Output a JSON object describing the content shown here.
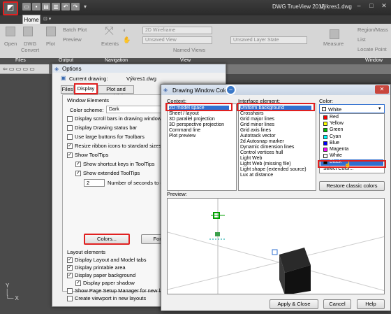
{
  "title_bar": {
    "app_name": "DWG TrueView 2012",
    "document": "Výkres1.dwg"
  },
  "tabs": {
    "home": "Home"
  },
  "ribbon": {
    "open": "Open",
    "dwg_convert_1": "DWG",
    "dwg_convert_2": "Convert",
    "plot": "Plot",
    "batch_plot": "Batch Plot",
    "preview": "Preview",
    "extents": "Extents",
    "visual_style": "2D Wireframe",
    "view": "Unsaved View",
    "named_views": "Named Views",
    "layer_state": "Unsaved Layer State",
    "measure": "Measure",
    "region_mass": "Region/Mass",
    "list": "List",
    "locate_point": "Locate Point",
    "panel_files": "Files",
    "panel_output": "Output",
    "panel_navigation": "Navigation",
    "panel_view": "View",
    "panel_window": "Window"
  },
  "options": {
    "title": "Options",
    "current_drawing_label": "Current drawing:",
    "current_drawing": "Výkres1.dwg",
    "tabs": [
      "Files",
      "Display",
      "Plot and Publish"
    ],
    "window_elements": "Window Elements",
    "color_scheme_label": "Color scheme:",
    "color_scheme": "Dark",
    "checks": [
      {
        "label": "Display scroll bars in drawing window",
        "checked": false
      },
      {
        "label": "Display Drawing status bar",
        "checked": false
      },
      {
        "label": "Use large buttons for Toolbars",
        "checked": false
      },
      {
        "label": "Resize ribbon icons to standard sizes",
        "checked": true
      },
      {
        "label": "Show ToolTips",
        "checked": true
      }
    ],
    "sub_checks": [
      {
        "label": "Show shortcut keys in ToolTips",
        "checked": true
      },
      {
        "label": "Show extended ToolTips",
        "checked": true
      }
    ],
    "tooltip_delay": "2",
    "tooltip_delay_label": "Number of seconds to de",
    "colors_button": "Colors...",
    "fonts_button": "Fonts...",
    "layout_elements": "Layout elements",
    "layout_checks": [
      {
        "label": "Display Layout and Model tabs",
        "checked": true
      },
      {
        "label": "Display printable area",
        "checked": true
      },
      {
        "label": "Display paper background",
        "checked": true
      },
      {
        "label": "Display paper shadow",
        "checked": true
      },
      {
        "label": "Show Page Setup Manager for new layout",
        "checked": false
      },
      {
        "label": "Create viewport in new layouts",
        "checked": false
      }
    ]
  },
  "dwc": {
    "title": "Drawing Window Colors",
    "context_label": "Context:",
    "contexts": [
      "2D model space",
      "Sheet / layout",
      "3D parallel projection",
      "3D perspective projection",
      "Command line",
      "Plot preview"
    ],
    "interface_label": "Interface element:",
    "elements": [
      "Uniform background",
      "Crosshairs",
      "Grid major lines",
      "Grid minor lines",
      "Grid axis lines",
      "Autotrack vector",
      "2d Autosnap marker",
      "Dynamic dimension lines",
      "Control vertices hull",
      "Light Web",
      "Light Web (missing file)",
      "Light shape (extended source)",
      "Lux at distance"
    ],
    "color_label": "Color:",
    "color_value": "White",
    "colors": [
      {
        "name": "Red",
        "hex": "#ff0000"
      },
      {
        "name": "Yellow",
        "hex": "#ffff00"
      },
      {
        "name": "Green",
        "hex": "#00c000"
      },
      {
        "name": "Cyan",
        "hex": "#00ffff"
      },
      {
        "name": "Blue",
        "hex": "#0000ff"
      },
      {
        "name": "Magenta",
        "hex": "#ff00ff"
      },
      {
        "name": "White",
        "hex": "#ffffff"
      },
      {
        "name": "Black",
        "hex": "#000000"
      },
      {
        "name": "Select Color...",
        "hex": ""
      }
    ],
    "restore_button": "Restore classic colors",
    "preview_label": "Preview:",
    "apply_button": "Apply & Close",
    "cancel_button": "Cancel",
    "help_button": "Help"
  }
}
